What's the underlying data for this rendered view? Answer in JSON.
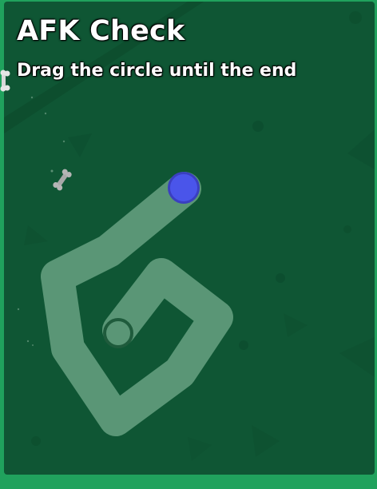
{
  "afk_check": {
    "title": "AFK Check",
    "instruction": "Drag the circle until the end"
  },
  "colors": {
    "panel_background": "#0f5634",
    "border": "#20a25d",
    "track": "#5f9a7a",
    "handle": "#4a55ea"
  },
  "icons": {
    "background_decoration": "bone-icon"
  }
}
